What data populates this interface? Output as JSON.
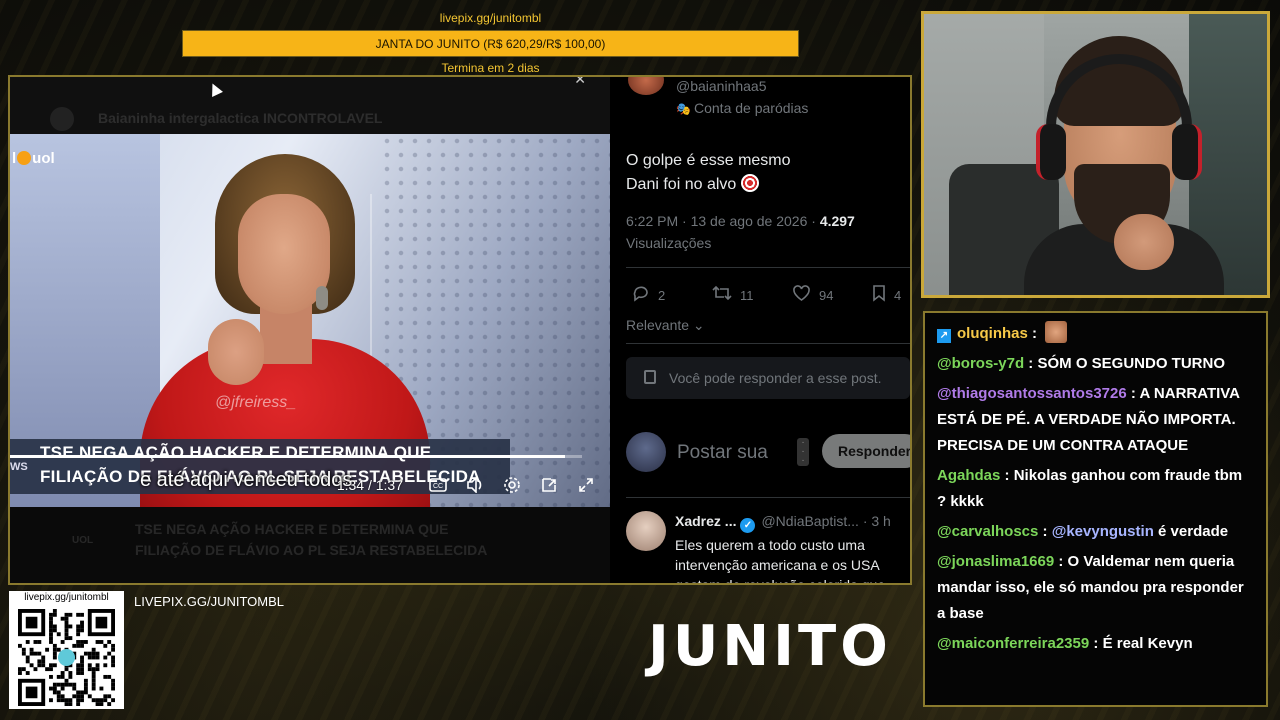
{
  "goal": {
    "url": "livepix.gg/junitombl",
    "label": "JANTA DO JUNITO (R$ 620,29/R$ 100,00)",
    "progress_percent": 100,
    "ends": "Termina em 2 dias"
  },
  "video": {
    "channel_logo": "uol",
    "watermark": "@jfreiress_",
    "headline_line1": "TSE NEGA AÇÃO HACKER E DETERMINA QUE",
    "headline_line2": "FILIAÇÃO DE FLÁVIO AO PL SEJA RESTABELECIDA",
    "ws_tag": "WS",
    "caption": "e até aqui venceu todos",
    "current_time": "1:34",
    "time_separator": "/",
    "duration": "1:37",
    "progress_fraction": 0.97,
    "ghost_title": "Baianinha intergalactica INCONTROLAVEL",
    "ghost_channel": "UOL",
    "icons": [
      "cc-icon",
      "volume-icon",
      "settings-icon",
      "pip-icon",
      "fullscreen-icon"
    ]
  },
  "tweet": {
    "handle": "@baianinhaa5",
    "parody_label": "Conta de paródias",
    "text_line1": "O golpe é esse mesmo",
    "text_line2": "Dani foi no alvo",
    "time": "6:22 PM · 13 de ago de 2026 · ",
    "views_count": "4.297",
    "views_label": "Visualizações",
    "replies": "2",
    "retweets": "11",
    "likes": "94",
    "bookmarks": "4",
    "sort_label": "Relevante",
    "reply_restricted": "Você pode responder a esse post.",
    "compose_placeholder": "Postar sua",
    "compose_button": "Responder",
    "reply_name": "Xadrez ...",
    "reply_meta": "@NdiaBaptist... · 3 h",
    "reply_text": "Eles querem a todo custo uma intervenção americana e os USA gostam de revolução colorida que"
  },
  "chat": {
    "messages": [
      {
        "user": "oluqinhas",
        "color": "#f7c948",
        "text": "",
        "prime": true,
        "emote": true
      },
      {
        "user": "@boros-y7d",
        "color": "#7cd65a",
        "text": "SÓM O SEGUNDO TURNO"
      },
      {
        "user": "@thiagosantossantos3726",
        "color": "#b07be8",
        "text": "A NARRATIVA ESTÁ DE PÉ. A VERDADE NÃO IMPORTA. PRECISA DE UM CONTRA ATAQUE"
      },
      {
        "user": "Agahdas",
        "color": "#7cd65a",
        "text": "Nikolas ganhou com fraude tbm ? kkkk"
      },
      {
        "user": "@carvalhoscs",
        "color": "#7cd65a",
        "mention": "@kevyngustin",
        "text": "é verdade"
      },
      {
        "user": "@jonaslima1669",
        "color": "#7cd65a",
        "text": "O Valdemar nem queria mandar isso, ele só mandou pra responder a base"
      },
      {
        "user": "@maiconferreira2359",
        "color": "#7cd65a",
        "text": "É real Kevyn"
      }
    ]
  },
  "branding": {
    "qr_url": "livepix.gg/junitombl",
    "url": "LIVEPIX.GG/JUNITOMBL",
    "logo": "JUNITO"
  },
  "colors": {
    "accent_gold": "#caa83a",
    "goal_fill": "#f7b417",
    "twitter_blue": "#1d9bf0",
    "news_red": "#c01818"
  }
}
